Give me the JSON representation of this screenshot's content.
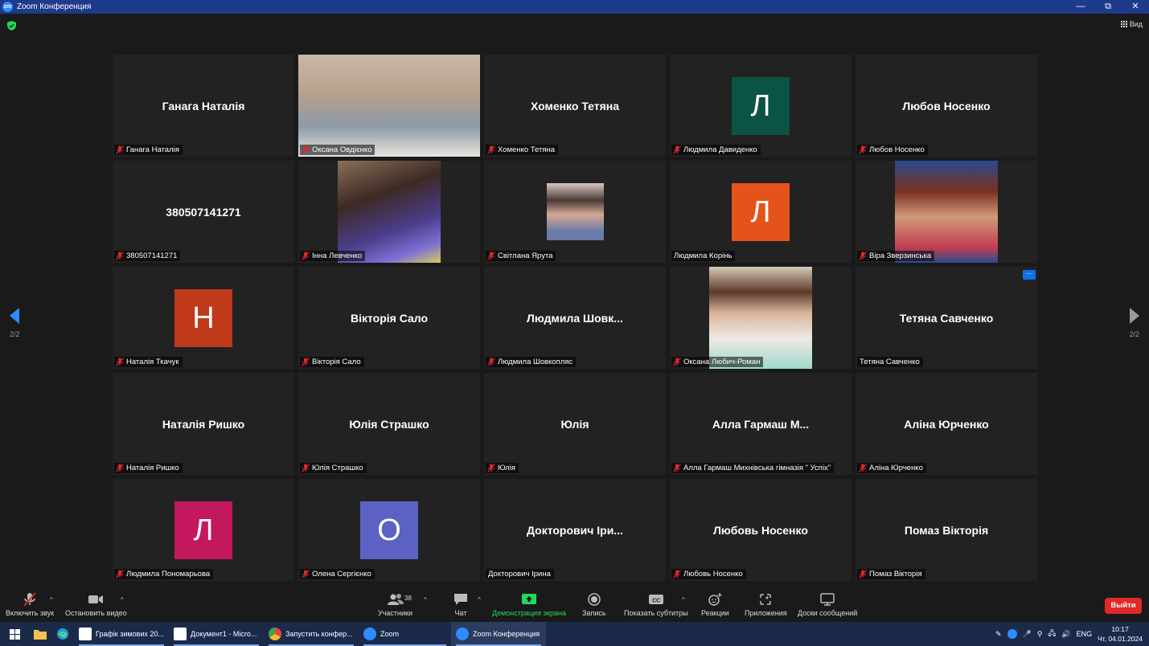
{
  "window": {
    "title": "Zoom Конференция",
    "logo": "zm",
    "buttons": [
      "minimize",
      "restore",
      "close"
    ]
  },
  "view_button": {
    "label": "Вид",
    "icon": "grid-icon"
  },
  "pager": {
    "left": "2/2",
    "right": "2/2"
  },
  "participants": [
    {
      "display": "Ганага Наталія",
      "label": "Ганага Наталія",
      "muted": true,
      "type": "name"
    },
    {
      "label": "Оксана Овдієнко",
      "muted": true,
      "type": "video"
    },
    {
      "display": "Хоменко Тетяна",
      "label": "Хоменко Тетяна",
      "muted": true,
      "type": "name"
    },
    {
      "initial": "Л",
      "label": "Людмила Давиденко",
      "muted": true,
      "type": "initial",
      "color": "#0b5343"
    },
    {
      "display": "Любов Носенко",
      "label": "Любов Носенко",
      "muted": true,
      "type": "name"
    },
    {
      "display": "380507141271",
      "label": "380507141271",
      "muted": true,
      "type": "name"
    },
    {
      "label": "Інна Левченко",
      "muted": true,
      "type": "photo"
    },
    {
      "label": "Світлана Ярута",
      "muted": true,
      "type": "photo-small"
    },
    {
      "initial": "Л",
      "label": "Людмила Корінь",
      "muted": false,
      "type": "initial",
      "color": "#e5531a"
    },
    {
      "label": "Віра Зверзинська",
      "muted": true,
      "type": "photo"
    },
    {
      "initial": "Н",
      "label": "Наталія Ткачук",
      "muted": true,
      "type": "initial",
      "color": "#c0391b"
    },
    {
      "display": "Вікторія Сало",
      "label": "Вікторія Сало",
      "muted": true,
      "type": "name"
    },
    {
      "display": "Людмила  Шовк...",
      "label": "Людмила Шовкопляс",
      "muted": true,
      "type": "name"
    },
    {
      "label": "Оксана Любич-Роман",
      "muted": true,
      "type": "photo"
    },
    {
      "display": "Тетяна Савченко",
      "label": "Тетяна Савченко",
      "muted": false,
      "type": "name",
      "more": "···"
    },
    {
      "display": "Наталія Ришко",
      "label": "Наталія Ришко",
      "muted": true,
      "type": "name"
    },
    {
      "display": "Юлія Страшко",
      "label": "Юлія Страшко",
      "muted": true,
      "type": "name"
    },
    {
      "display": "Юлія",
      "label": "Юлія",
      "muted": true,
      "type": "name"
    },
    {
      "display": "Алла  Гармаш  М...",
      "label": "Алла Гармаш Михнівська гімназія \" Успіх\"",
      "muted": true,
      "type": "name"
    },
    {
      "display": "Аліна Юрченко",
      "label": "Аліна Юрченко",
      "muted": true,
      "type": "name"
    },
    {
      "initial": "Л",
      "label": "Людмила Пономарьова",
      "muted": true,
      "type": "initial",
      "color": "#c3185d"
    },
    {
      "initial": "О",
      "label": "Олена Сергієнко",
      "muted": true,
      "type": "initial",
      "color": "#5b62c4"
    },
    {
      "display": "Докторович Іри...",
      "label": "Докторович Ірина",
      "muted": false,
      "type": "name"
    },
    {
      "display": "Любовь Носенко",
      "label": "Любовь Носенко",
      "muted": true,
      "type": "name"
    },
    {
      "display": "Помаз Вікторія",
      "label": "Помаз Вікторія",
      "muted": true,
      "type": "name"
    }
  ],
  "toolbar": {
    "unmute": "Включить звук",
    "stop_video": "Остановить видео",
    "participants": "Участники",
    "participants_count": "38",
    "chat": "Чат",
    "share": "Демонстрация экрана",
    "record": "Запись",
    "captions": "Показать субтитры",
    "captions_icon_text": "CC",
    "reactions": "Реакции",
    "apps": "Приложения",
    "whiteboards": "Доски сообщений",
    "leave": "Выйти",
    "caret": "^"
  },
  "colors": {
    "zoom_blue": "#2d8cff",
    "share_green": "#23d959",
    "leave_red": "#e02828",
    "mute_red": "#e02828"
  },
  "taskbar": {
    "apps": [
      {
        "label": "Графік зимових 20...",
        "icon": "word-icon"
      },
      {
        "label": "Документ1 - Micro...",
        "icon": "word-icon"
      },
      {
        "label": "Запустить конфер...",
        "icon": "chrome-icon"
      },
      {
        "label": "Zoom",
        "icon": "zoom-icon"
      },
      {
        "label": "Zoom Конференция",
        "icon": "zoom-icon"
      }
    ],
    "language": "ENG",
    "time": "10:17",
    "date": "Чт, 04.01.2024"
  }
}
